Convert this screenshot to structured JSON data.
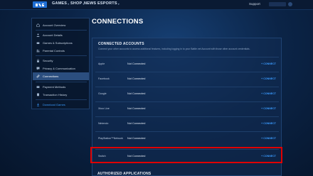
{
  "nav": {
    "logo_label": "",
    "items": [
      {
        "label": "GAMES",
        "has_chevron": true
      },
      {
        "label": "SHOP",
        "has_chevron": true
      },
      {
        "label": "NEWS",
        "has_chevron": false
      },
      {
        "label": "ESPORTS",
        "has_chevron": true
      }
    ],
    "support": "Support"
  },
  "sidebar": {
    "items": [
      {
        "label": "Account Overview",
        "icon": "home-icon"
      },
      {
        "label": "Account Details",
        "icon": "user-icon"
      },
      {
        "label": "Games & Subscriptions",
        "icon": "gamepad-icon"
      },
      {
        "label": "Parental Controls",
        "icon": "family-icon"
      },
      {
        "label": "Security",
        "icon": "lock-icon"
      },
      {
        "label": "Privacy & Communication",
        "icon": "chat-icon"
      },
      {
        "label": "Connections",
        "icon": "link-icon",
        "active": true
      },
      {
        "label": "Payment Methods",
        "icon": "card-icon"
      },
      {
        "label": "Transaction History",
        "icon": "receipt-icon"
      },
      {
        "label": "Download Games",
        "icon": "download-icon",
        "link": true
      }
    ]
  },
  "page": {
    "title": "CONNECTIONS"
  },
  "connected_accounts": {
    "heading": "CONNECTED ACCOUNTS",
    "description": "Connect your other accounts to access additional features, including logging in to your Battle.net Account with those other account credentials.",
    "rows": [
      {
        "name": "Apple",
        "status": "Not Connected",
        "action": "+ CONNECT"
      },
      {
        "name": "Facebook",
        "status": "Not Connected",
        "action": "+ CONNECT"
      },
      {
        "name": "Google",
        "status": "Not Connected",
        "action": "+ CONNECT"
      },
      {
        "name": "Xbox Live",
        "status": "Not Connected",
        "action": "+ CONNECT"
      },
      {
        "name": "Nintendo",
        "status": "Not Connected",
        "action": "+ CONNECT"
      },
      {
        "name": "PlayStation™Network",
        "status": "Not Connected",
        "action": "+ CONNECT"
      },
      {
        "name": "Switch",
        "status": "Not Connected",
        "action": "+ CONNECT"
      }
    ]
  },
  "authorized_apps": {
    "heading": "AUTHORIZED APPLICATIONS"
  },
  "colors": {
    "accent": "#3a9bff",
    "highlight": "#e00000",
    "active_item": "#2b4e7f"
  }
}
